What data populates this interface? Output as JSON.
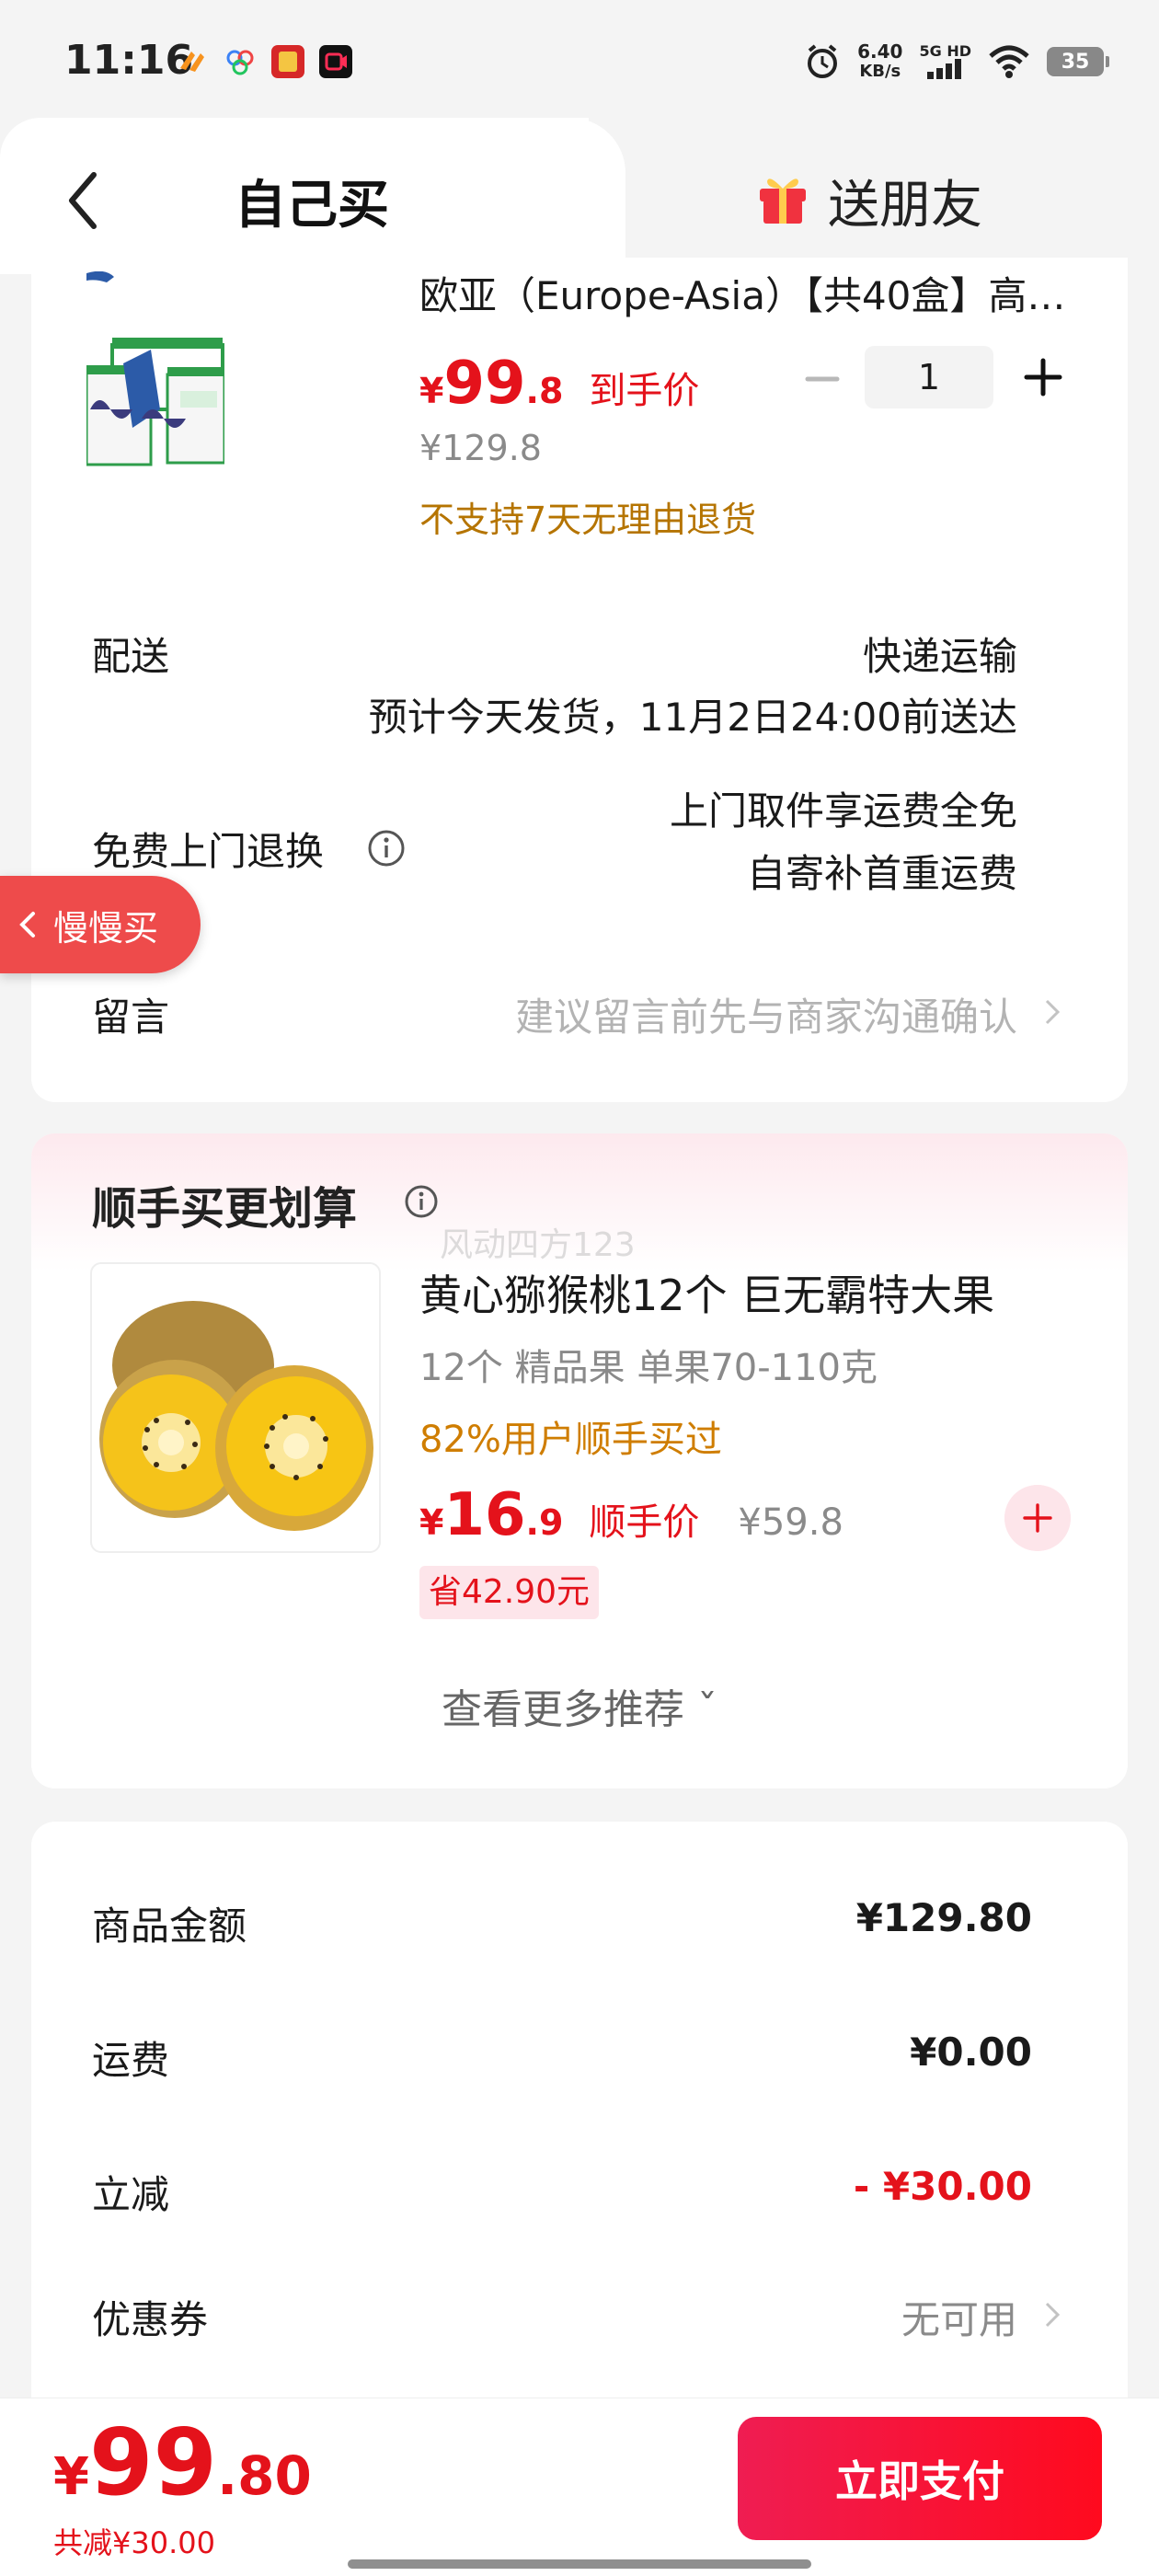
{
  "status_bar": {
    "time": "11:16",
    "net_speed_value": "6.40",
    "net_speed_unit": "KB/s",
    "net_type": "5G HD",
    "battery": "35"
  },
  "tabs": {
    "self": "自己买",
    "friend": "送朋友"
  },
  "order": {
    "product_title": "欧亚（Europe-Asia）【共40盒】高…",
    "price_yen": "¥",
    "price_int": "99",
    "price_dec": ".8",
    "price_label": "到手价",
    "original_price": "¥129.8",
    "return_note": "不支持7天无理由退货",
    "quantity": "1",
    "delivery_label": "配送",
    "delivery_method": "快递运输",
    "delivery_eta": "预计今天发货，11月2日24:00前送达",
    "free_return_label": "免费上门退换",
    "free_return_line1": "上门取件享运费全免",
    "free_return_line2": "自寄补首重运费",
    "message_label": "留言",
    "message_placeholder": "建议留言前先与商家沟通确认"
  },
  "floating": {
    "slow_buy": "慢慢买"
  },
  "combo": {
    "title": "顺手买更划算",
    "watermark": "风动四方123",
    "name": "黄心猕猴桃12个 巨无霸特大果",
    "spec": "12个 精品果 单果70-110克",
    "bought": "82%用户顺手买过",
    "price_yen": "¥",
    "price_int": "16",
    "price_dec": ".9",
    "price_label": "顺手价",
    "original_price": "¥59.8",
    "save": "省42.90元",
    "see_more": "查看更多推荐 ˇ"
  },
  "summary": {
    "goods_label": "商品金额",
    "goods_value": "¥129.80",
    "shipping_label": "运费",
    "shipping_value": "¥0.00",
    "discount_label": "立减",
    "discount_value": "- ¥30.00",
    "coupon_label": "优惠券",
    "coupon_value": "无可用"
  },
  "bottom": {
    "total_yen": "¥",
    "total_int": "99",
    "total_dec": ".80",
    "total_discount": "共减¥30.00",
    "pay_button": "立即支付"
  },
  "colors": {
    "accent_red": "#e4121b",
    "pay_button": "#ff0a1e",
    "warning_orange": "#b57400",
    "slow_buy": "#ee4b4b"
  }
}
